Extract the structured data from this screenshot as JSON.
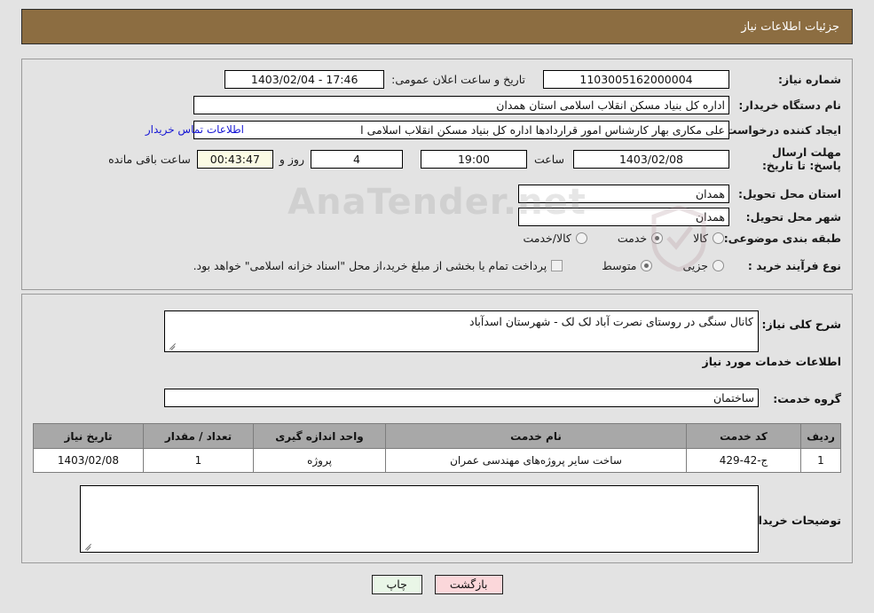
{
  "header": {
    "title": "جزئیات اطلاعات نیاز",
    "bg_color": "#8c6d41"
  },
  "form": {
    "need_number_label": "شماره نیاز:",
    "need_number_value": "1103005162000004",
    "announce_datetime_label": "تاریخ و ساعت اعلان عمومی:",
    "announce_datetime_value": "1403/02/04 - 17:46",
    "buyer_org_label": "نام دستگاه خریدار:",
    "buyer_org_value": "اداره کل بنیاد مسکن انقلاب اسلامی استان همدان",
    "creator_label": "ایجاد کننده درخواست:",
    "creator_value": "علی مکاری بهار کارشناس امور قراردادها اداره کل بنیاد مسکن انقلاب اسلامی ا",
    "contact_link": "اطلاعات تماس خریدار",
    "deadline_label": "مهلت ارسال پاسخ: تا تاریخ:",
    "deadline_date": "1403/02/08",
    "hour_label": "ساعت",
    "hour_value": "19:00",
    "days_value": "4",
    "days_suffix": "روز و",
    "countdown_value": "00:43:47",
    "countdown_suffix": "ساعت باقی مانده",
    "province_label": "استان محل تحویل:",
    "province_value": "همدان",
    "city_label": "شهر محل تحویل:",
    "city_value": "همدان",
    "category_label": "طبقه بندی موضوعی:",
    "category_options": [
      {
        "label": "کالا",
        "selected": false
      },
      {
        "label": "خدمت",
        "selected": true
      },
      {
        "label": "کالا/خدمت",
        "selected": false
      }
    ],
    "process_label": "نوع فرآیند خرید :",
    "process_options": [
      {
        "label": "جزیی",
        "selected": false
      },
      {
        "label": "متوسط",
        "selected": true
      }
    ],
    "treasury_checkbox_label": "پرداخت تمام یا بخشی از مبلغ خرید،از محل \"اسناد خزانه اسلامی\" خواهد بود.",
    "treasury_checked": false
  },
  "description": {
    "general_need_label": "شرح کلی نیاز:",
    "general_need_value": "کانال سنگی در روستای نصرت آباد لک لک - شهرستان اسدآباد",
    "services_info_heading": "اطلاعات خدمات مورد نیاز",
    "service_group_label": "گروه خدمت:",
    "service_group_value": "ساختمان",
    "buyer_notes_label": "توضیحات خریدار:",
    "buyer_notes_value": ""
  },
  "table": {
    "columns": [
      "ردیف",
      "کد خدمت",
      "نام خدمت",
      "واحد اندازه گیری",
      "تعداد / مقدار",
      "تاریخ نیاز"
    ],
    "rows": [
      {
        "row_no": "1",
        "service_code": "ج-42-429",
        "service_name": "ساخت سایر پروژه‌های مهندسی عمران",
        "unit": "پروژه",
        "quantity": "1",
        "need_date": "1403/02/08"
      }
    ]
  },
  "buttons": {
    "print": "چاپ",
    "back": "بازگشت"
  },
  "watermark": {
    "text": "AnaTender.net"
  }
}
